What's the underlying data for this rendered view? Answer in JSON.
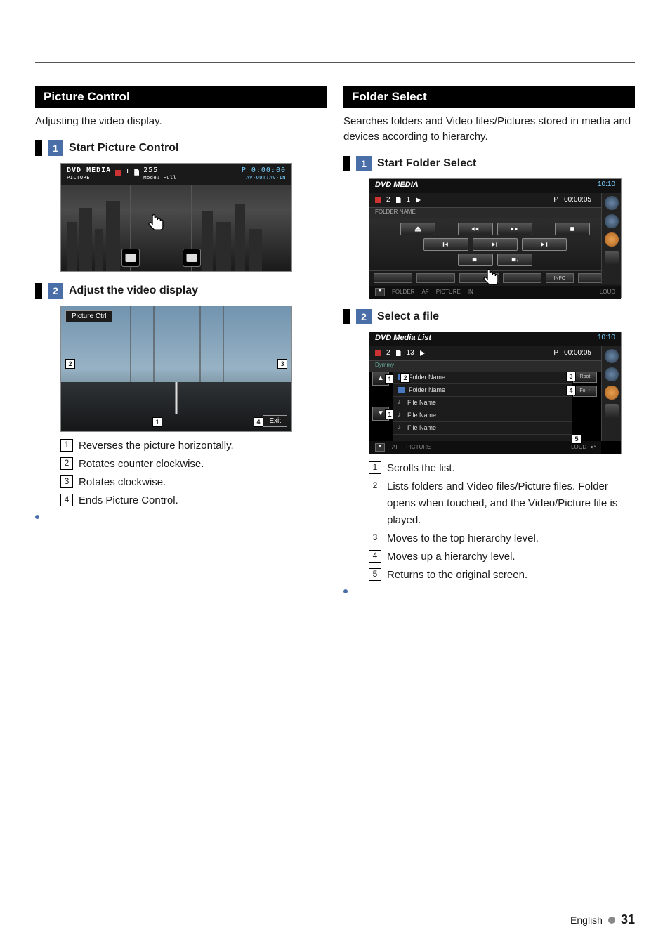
{
  "left": {
    "section_title": "Picture Control",
    "intro": "Adjusting the video display.",
    "step1_num": "1",
    "step1_title": "Start Picture Control",
    "shot1": {
      "title_left": "DVD",
      "title_right": "MEDIA",
      "title_sub": "PICTURE",
      "stop_num": "1",
      "doc_num": "255",
      "mode": "Mode: Full",
      "p_time": "P 0:00:00",
      "avout": "AV-OUT:AV-IN"
    },
    "step2_num": "2",
    "step2_title": "Adjust the video display",
    "shot2": {
      "label": "Picture Ctrl",
      "exit": "Exit",
      "c1": "1",
      "c2": "2",
      "c3": "3",
      "c4": "4"
    },
    "legend": {
      "n1": "1",
      "t1": "Reverses the picture horizontally.",
      "n2": "2",
      "t2": "Rotates counter clockwise.",
      "n3": "3",
      "t3": "Rotates clockwise.",
      "n4": "4",
      "t4": "Ends Picture Control."
    }
  },
  "right": {
    "section_title": "Folder Select",
    "intro": "Searches folders and Video files/Pictures stored in media and devices according to hierarchy.",
    "step1_num": "1",
    "step1_title": "Start Folder Select",
    "shot3": {
      "title": "DVD MEDIA",
      "time": "10:10",
      "row_num1": "2",
      "row_num2": "1",
      "row_p": "P",
      "row_time": "00:00:05",
      "folder_name": "FOLDER NAME",
      "info": "INFO",
      "folder": "FOLDER",
      "af": "AF",
      "picture": "PICTURE",
      "in": "IN",
      "loud": "LOUD"
    },
    "step2_num": "2",
    "step2_title": "Select a file",
    "shot4": {
      "title": "DVD Media List",
      "time": "10:10",
      "row_num1": "2",
      "row_num2": "13",
      "row_p": "P",
      "row_time": "00:00:05",
      "dymmy": "Dymmy",
      "items": [
        "Folder Name",
        "Folder Name",
        "File Name",
        "File Name",
        "File Name"
      ],
      "root": "Root",
      "folup": "Fol ↑",
      "picture": "PICTURE",
      "af": "AF",
      "loud": "LOUD",
      "c1": "1",
      "c2": "2",
      "c3": "3",
      "c4": "4",
      "c5": "5"
    },
    "legend": {
      "n1": "1",
      "t1": "Scrolls the list.",
      "n2": "2",
      "t2": "Lists folders and Video files/Picture files. Folder opens when touched, and the Video/Picture file is played.",
      "n3": "3",
      "t3": "Moves to the top hierarchy level.",
      "n4": "4",
      "t4": "Moves up a hierarchy level.",
      "n5": "5",
      "t5": "Returns to the original screen."
    }
  },
  "footer": {
    "lang": "English",
    "page": "31"
  }
}
